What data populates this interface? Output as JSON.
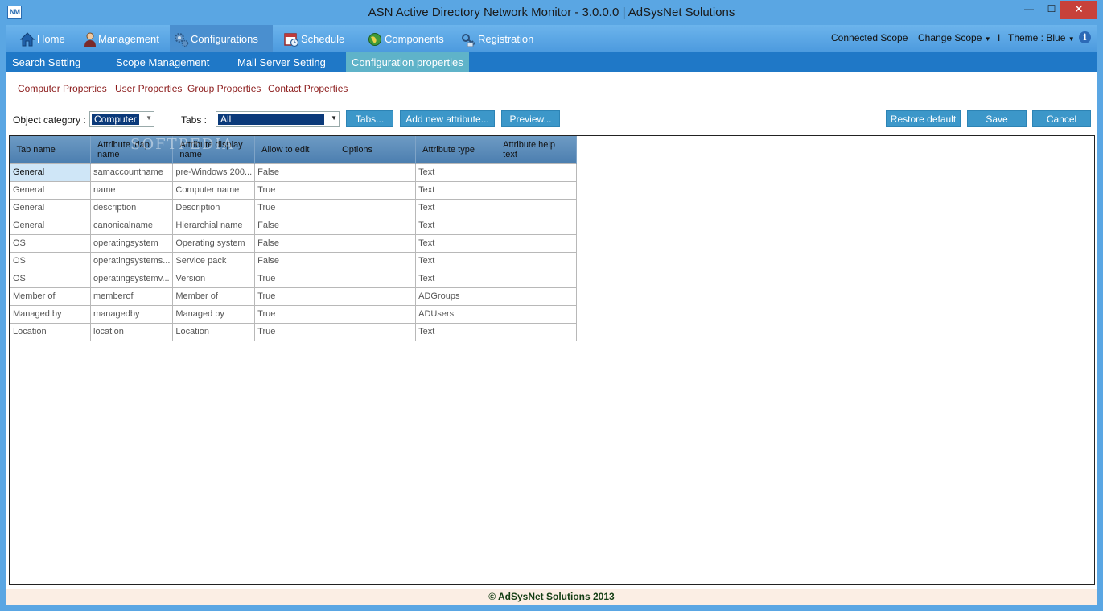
{
  "window": {
    "title": "ASN Active Directory Network Monitor - 3.0.0.0 | AdSysNet Solutions",
    "logo_text": "NM",
    "min_glyph": "—",
    "max_glyph": "☐",
    "close_glyph": "✕"
  },
  "mainnav": {
    "items": [
      {
        "label": "Home",
        "icon": "house-icon"
      },
      {
        "label": "Management",
        "icon": "user-icon"
      },
      {
        "label": "Configurations",
        "icon": "gears-icon"
      },
      {
        "label": "Schedule",
        "icon": "calendar-clock-icon"
      },
      {
        "label": "Components",
        "icon": "globe-icon"
      },
      {
        "label": "Registration",
        "icon": "key-icon"
      }
    ],
    "connected_scope": "Connected Scope",
    "change_scope": "Change Scope",
    "separator": "I",
    "theme": "Theme : Blue",
    "info": "i"
  },
  "subnav": {
    "items": [
      "Search Setting",
      "Scope Management",
      "Mail Server Setting",
      "Configuration properties"
    ]
  },
  "properties_links": [
    "Computer Properties",
    "User Properties",
    "Group Properties",
    "Contact Properties"
  ],
  "filters": {
    "object_category_label": "Object category :",
    "object_category_value": "Computer",
    "tabs_label": "Tabs :",
    "tabs_value": "All"
  },
  "buttons": {
    "tabs": "Tabs...",
    "add_attribute": "Add new attribute...",
    "preview": "Preview...",
    "restore": "Restore default",
    "save": "Save",
    "cancel": "Cancel"
  },
  "grid": {
    "watermark": "SOFTPEDIA",
    "columns": [
      "Tab name",
      "Attribute ldap name",
      "Attribute display name",
      "Allow to edit",
      "Options",
      "Attribute type",
      "Attribute help text"
    ],
    "rows": [
      [
        "General",
        "samaccountname",
        "pre-Windows 200...",
        "False",
        "",
        "Text",
        ""
      ],
      [
        "General",
        "name",
        "Computer name",
        "True",
        "",
        "Text",
        ""
      ],
      [
        "General",
        "description",
        "Description",
        "True",
        "",
        "Text",
        ""
      ],
      [
        "General",
        "canonicalname",
        "Hierarchial name",
        "False",
        "",
        "Text",
        ""
      ],
      [
        "OS",
        "operatingsystem",
        "Operating system",
        "False",
        "",
        "Text",
        ""
      ],
      [
        "OS",
        "operatingsystems...",
        "Service pack",
        "False",
        "",
        "Text",
        ""
      ],
      [
        "OS",
        "operatingsystemv...",
        "Version",
        "True",
        "",
        "Text",
        ""
      ],
      [
        "Member of",
        "memberof",
        "Member of",
        "True",
        "",
        "ADGroups",
        ""
      ],
      [
        "Managed by",
        "managedby",
        "Managed by",
        "True",
        "",
        "ADUsers",
        ""
      ],
      [
        "Location",
        "location",
        "Location",
        "True",
        "",
        "Text",
        ""
      ]
    ]
  },
  "footer": "© AdSysNet Solutions 2013"
}
